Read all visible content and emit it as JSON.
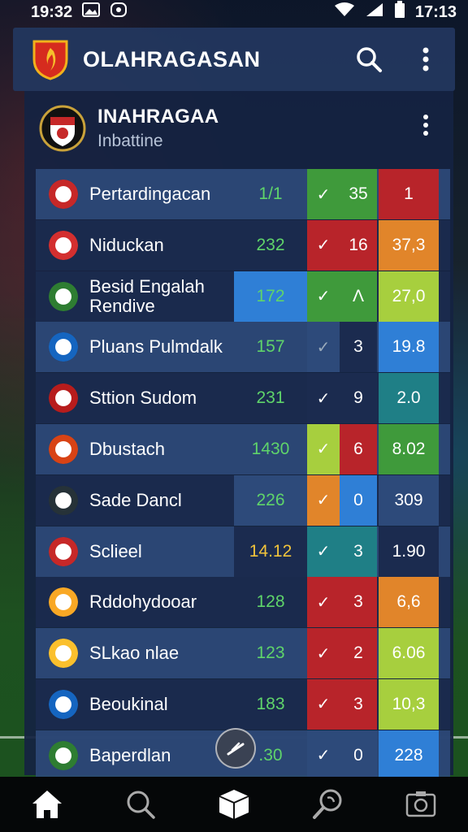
{
  "status_bar": {
    "time_left": "19:32",
    "time_right": "17:13"
  },
  "app_bar": {
    "title": "OLAHRAGASAN"
  },
  "league": {
    "title": "INAHRAGAA",
    "subtitle": "Inbattine"
  },
  "colors": {
    "green": "#3f9a3b",
    "red": "#b8242a",
    "orange": "#e1852a",
    "lime": "#a7cf3e",
    "blue": "#2f7fd6",
    "teal": "#1f7f86",
    "row_dark": "#1b2b4f",
    "row_light": "#2d4a7a"
  },
  "rows": [
    {
      "name": "Pertardingacan",
      "stat": "1/1",
      "check": "✓",
      "num": "35",
      "score": "1"
    },
    {
      "name": "Niduckan",
      "stat": "232",
      "check": "✓",
      "num": "16",
      "score": "37,3"
    },
    {
      "name": "Besid Engalah Rendive",
      "stat": "172",
      "check": "✓",
      "num": "Λ",
      "score": "27,0"
    },
    {
      "name": "Pluans Pulmdalk",
      "stat": "157",
      "check": "✓",
      "num": "3",
      "score": "19.8"
    },
    {
      "name": "Sttion Sudom",
      "stat": "231",
      "check": "✓",
      "num": "9",
      "score": "2.0"
    },
    {
      "name": "Dbustach",
      "stat": "1430",
      "check": "✓",
      "num": "6",
      "score": "8.02"
    },
    {
      "name": "Sade Dancl",
      "stat": "226",
      "check": "✓",
      "num": "0",
      "score": "309"
    },
    {
      "name": "Sclieel",
      "stat": "14.12",
      "check": "✓",
      "num": "3",
      "score": "1.90"
    },
    {
      "name": "Rddohydooar",
      "stat": "128",
      "check": "✓",
      "num": "3",
      "score": "6,6"
    },
    {
      "name": "SLkao nlae",
      "stat": "123",
      "check": "✓",
      "num": "2",
      "score": "6.06"
    },
    {
      "name": "Beoukinal",
      "stat": "183",
      "check": "✓",
      "num": "3",
      "score": "10,3"
    },
    {
      "name": "Baperdlan",
      "stat": ".30",
      "check": "✓",
      "num": "0",
      "score": "228"
    }
  ]
}
